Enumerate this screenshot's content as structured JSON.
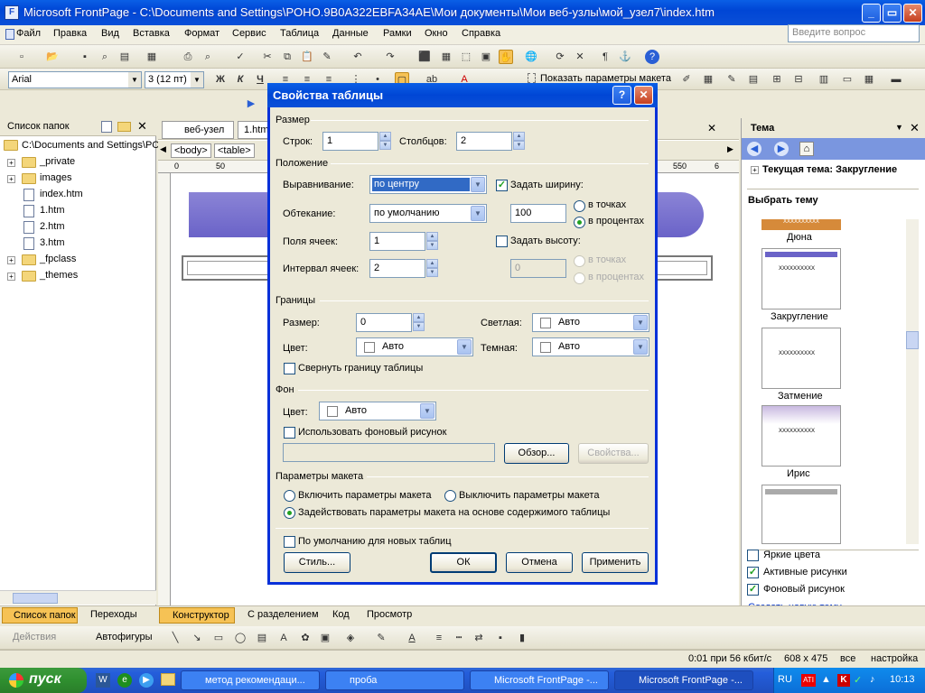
{
  "window": {
    "title": "Microsoft FrontPage - C:\\Documents and Settings\\POHO.9B0A322EBFA34AE\\Мои документы\\Мои веб-узлы\\мой_узел7\\index.htm"
  },
  "menu": [
    "Файл",
    "Правка",
    "Вид",
    "Вставка",
    "Формат",
    "Сервис",
    "Таблица",
    "Данные",
    "Рамки",
    "Окно",
    "Справка"
  ],
  "ask_placeholder": "Введите вопрос",
  "format_toolbar": {
    "font": "Arial",
    "size": "3 (12 пт)",
    "show_params": "Показать параметры макета"
  },
  "folder_list": {
    "header": "Список папок",
    "root": "C:\\Documents and Settings\\PC",
    "items": [
      "_private",
      "images",
      "index.htm",
      "1.htm",
      "2.htm",
      "3.htm",
      "_fpclass",
      "_themes"
    ]
  },
  "editor": {
    "tabs": [
      "веб-узел",
      "1.htm"
    ],
    "tags": [
      "<body>",
      "<table>"
    ],
    "ruler": [
      "0",
      "50",
      "550",
      "6"
    ]
  },
  "theme_panel": {
    "header": "Тема",
    "current": "Текущая тема: Закругление",
    "choose": "Выбрать тему",
    "themes": [
      "Дюна",
      "Закругление",
      "Затмение",
      "Ирис"
    ],
    "thumb_text": "XXXXXXXXXX",
    "options": [
      {
        "label": "Яркие цвета",
        "checked": false
      },
      {
        "label": "Активные рисунки",
        "checked": true
      },
      {
        "label": "Фоновый рисунок",
        "checked": true
      }
    ],
    "create_link": "Создать новую тему..."
  },
  "dialog": {
    "title": "Свойства таблицы",
    "size_group": "Размер",
    "rows_label": "Строк:",
    "rows": "1",
    "cols_label": "Столбцов:",
    "cols": "2",
    "layout_group": "Положение",
    "align_label": "Выравнивание:",
    "align": "по центру",
    "float_label": "Обтекание:",
    "float": "по умолчанию",
    "padding_label": "Поля ячеек:",
    "padding": "1",
    "spacing_label": "Интервал ячеек:",
    "spacing": "2",
    "set_width": "Задать ширину:",
    "width": "100",
    "in_pixels": "в точках",
    "in_percent": "в процентах",
    "set_height": "Задать высоту:",
    "height": "0",
    "borders_group": "Границы",
    "border_size_label": "Размер:",
    "border_size": "0",
    "light_label": "Светлая:",
    "light": "Авто",
    "color_label": "Цвет:",
    "color": "Авто",
    "dark_label": "Темная:",
    "dark": "Авто",
    "collapse": "Свернуть границу таблицы",
    "bg_group": "Фон",
    "bg_color_label": "Цвет:",
    "bg_color": "Авто",
    "use_bg_image": "Использовать фоновый рисунок",
    "browse": "Обзор...",
    "properties": "Свойства...",
    "layout_tools_group": "Параметры макета",
    "enable_layout": "Включить параметры макета",
    "disable_layout": "Выключить параметры макета",
    "auto_layout": "Задействовать параметры макета на основе содержимого таблицы",
    "default_new": "По умолчанию для новых таблиц",
    "style": "Стиль...",
    "ok": "ОК",
    "cancel": "Отмена",
    "apply": "Применить"
  },
  "bottom_tabs": {
    "folders": "Список папок",
    "navigation": "Переходы",
    "design": "Конструктор",
    "split": "С разделением",
    "code": "Код",
    "preview": "Просмотр"
  },
  "drawing_toolbar": {
    "actions": "Действия",
    "autoshapes": "Автофигуры"
  },
  "status": {
    "speed": "0:01 при 56 кбит/с",
    "size": "608 x 475",
    "mode": "все",
    "custom": "настройка"
  },
  "taskbar": {
    "start": "пуск",
    "tasks": [
      "метод рекомендаци...",
      "проба",
      "Microsoft FrontPage -...",
      "Microsoft FrontPage -..."
    ],
    "lang": "RU",
    "time": "10:13"
  }
}
